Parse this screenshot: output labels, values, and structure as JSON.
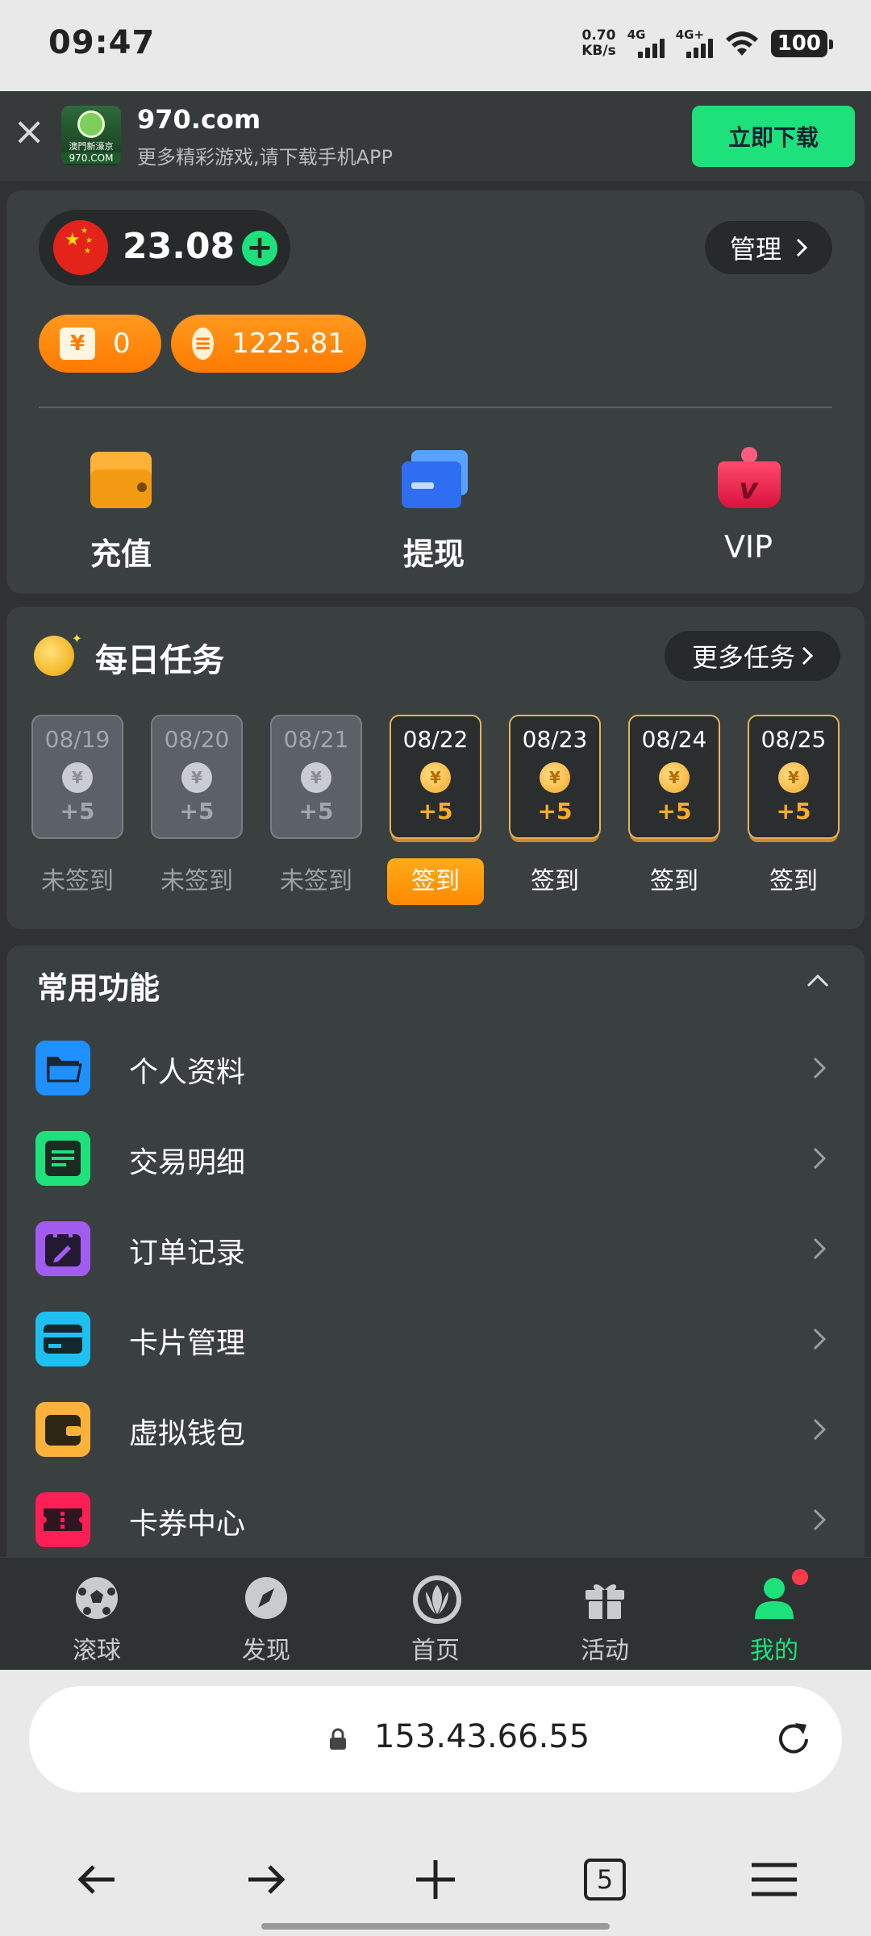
{
  "status_bar": {
    "time": "09:47",
    "net_speed_value": "0.70",
    "net_speed_unit": "KB/s",
    "sim1": "4G",
    "sim2": "4G+",
    "battery": "100"
  },
  "banner": {
    "close_icon": "close-icon",
    "logo_cn": "澳門新濠京",
    "logo_tag": "970.COM",
    "site": "970.com",
    "desc": "更多精彩游戏,请下载手机APP",
    "download_label": "立即下载"
  },
  "wallet": {
    "flag_icon": "china-flag-icon",
    "balance": "23.08",
    "manage_label": "管理",
    "ticket_count": "0",
    "coin_amount": "1225.81",
    "actions": [
      {
        "label": "充值",
        "icon": "wallet-icon"
      },
      {
        "label": "提现",
        "icon": "card-icon"
      },
      {
        "label": "VIP",
        "icon": "vip-icon"
      }
    ]
  },
  "daily_tasks": {
    "title": "每日任务",
    "more_label": "更多任务",
    "days": [
      {
        "date": "08/19",
        "points": "+5",
        "label": "未签到",
        "state": "past"
      },
      {
        "date": "08/20",
        "points": "+5",
        "label": "未签到",
        "state": "past"
      },
      {
        "date": "08/21",
        "points": "+5",
        "label": "未签到",
        "state": "past"
      },
      {
        "date": "08/22",
        "points": "+5",
        "label": "签到",
        "state": "today"
      },
      {
        "date": "08/23",
        "points": "+5",
        "label": "签到",
        "state": "future"
      },
      {
        "date": "08/24",
        "points": "+5",
        "label": "签到",
        "state": "future"
      },
      {
        "date": "08/25",
        "points": "+5",
        "label": "签到",
        "state": "future"
      }
    ]
  },
  "functions": {
    "title": "常用功能",
    "items": [
      {
        "label": "个人资料",
        "icon": "folder-icon",
        "color": "#1e90ff"
      },
      {
        "label": "交易明细",
        "icon": "document-icon",
        "color": "#1de27c"
      },
      {
        "label": "订单记录",
        "icon": "edit-calendar-icon",
        "color": "#a35cf0"
      },
      {
        "label": "卡片管理",
        "icon": "credit-card-icon",
        "color": "#1ec0f0"
      },
      {
        "label": "虚拟钱包",
        "icon": "wallet-icon",
        "color": "#ffb23a"
      },
      {
        "label": "卡券中心",
        "icon": "ticket-icon",
        "color": "#ff1f55"
      }
    ]
  },
  "bottom_nav": [
    {
      "label": "滚球",
      "icon": "soccer-ball-icon"
    },
    {
      "label": "发现",
      "icon": "compass-icon"
    },
    {
      "label": "首页",
      "icon": "home-logo-icon"
    },
    {
      "label": "活动",
      "icon": "gift-icon"
    },
    {
      "label": "我的",
      "icon": "user-icon",
      "active": true
    }
  ],
  "browser": {
    "url": "153.43.66.55",
    "tab_count": "5"
  },
  "colors": {
    "accent_green": "#1de27c",
    "accent_orange": "#ff8a00",
    "panel": "#3a3f40",
    "background": "#2e3233"
  }
}
